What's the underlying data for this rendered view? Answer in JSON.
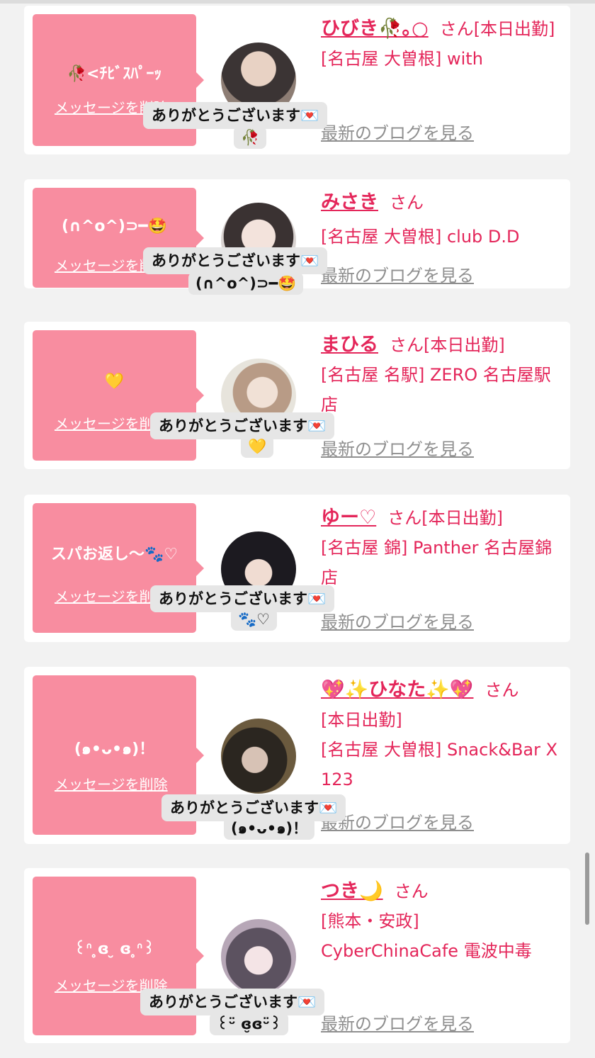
{
  "entries": [
    {
      "message": "🥀<ﾁﾋﾞｽﾊﾟｰｯ",
      "delete_label": "メッセージを削除",
      "name": "ひびき🥀｡○",
      "san": "さん",
      "status": "[本日出勤]",
      "shop": "[名古屋 大曽根] with",
      "blog_label": "最新のブログを見る",
      "thanks": "ありがとうございます💌",
      "thanks_sub": "🥀"
    },
    {
      "message": "(∩^o^)⊃━🤩",
      "delete_label": "メッセージを削除",
      "name": "みさき",
      "san": "さん",
      "status": "",
      "shop": "[名古屋 大曽根] club D.D",
      "blog_label": "最新のブログを見る",
      "thanks": "ありがとうございます💌",
      "thanks_sub": "(∩^o^)⊃━🤩"
    },
    {
      "message": "💛",
      "delete_label": "メッセージを削除",
      "name": "まひる",
      "san": "さん",
      "status": "[本日出勤]",
      "shop": "[名古屋 名駅] ZERO 名古屋駅店",
      "blog_label": "最新のブログを見る",
      "thanks": "ありがとうございます💌",
      "thanks_sub": "💛"
    },
    {
      "message": "スパお返し〜🐾♡",
      "delete_label": "メッセージを削除",
      "name": "ゆー♡",
      "san": "さん",
      "status": "[本日出勤]",
      "shop": "[名古屋 錦] Panther 名古屋錦店",
      "blog_label": "最新のブログを見る",
      "thanks": "ありがとうございます💌",
      "thanks_sub": "🐾♡"
    },
    {
      "message": "(๑•ᴗ•๑)！",
      "delete_label": "メッセージを削除",
      "name": "💖✨ひなた✨💖",
      "san": "さん",
      "status": "[本日出勤]",
      "shop": "[名古屋 大曽根] Snack&Bar X 123",
      "blog_label": "最新のブログを見る",
      "thanks": "ありがとうございます💌",
      "thanks_sub": "(๑•ᴗ•๑)！"
    },
    {
      "message": "꒰ᐢ ̥ɞ ̮ ɞ ̥ᐢ꒱",
      "delete_label": "メッセージを削除",
      "name": "つき🌙",
      "san": "さん",
      "status": "",
      "shop": "[熊本・安政] CyberChinaCafe 電波中毒",
      "blog_label": "最新のブログを見る",
      "thanks": "ありがとうございます💌",
      "thanks_sub": "꒰ᵕ̈ ɞ̮ɞᵕ̈꒱"
    }
  ],
  "colors": {
    "bubble": "#f88da0",
    "accent": "#e4265a",
    "link_gray": "#8f8f8f",
    "tooltip_bg": "#e6e6e6"
  }
}
